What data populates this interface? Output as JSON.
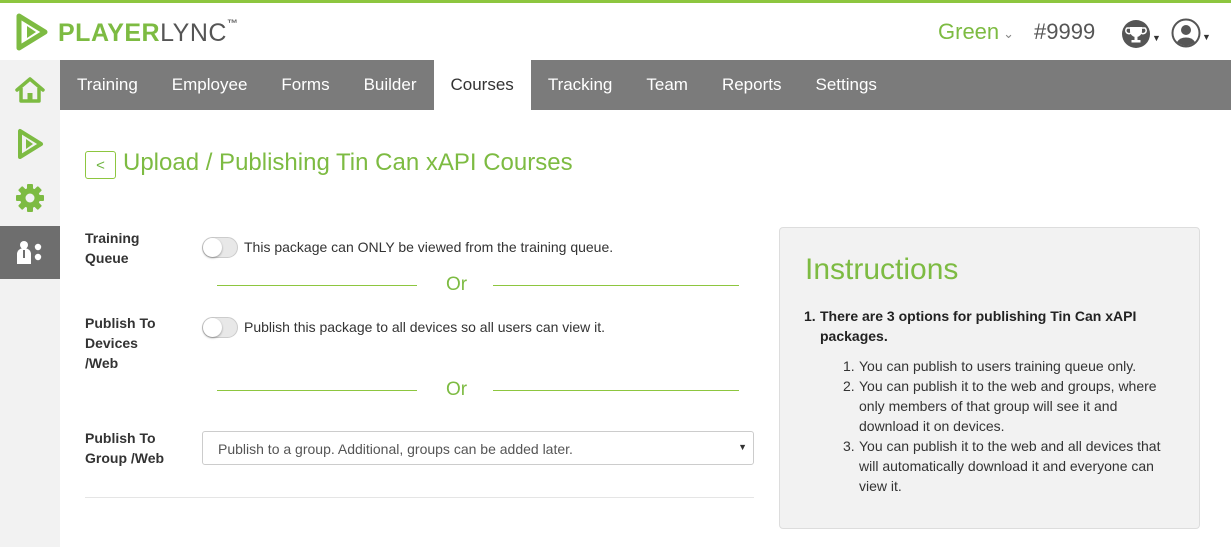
{
  "header": {
    "logo_player": "PLAYER",
    "logo_lync": "LYNC",
    "logo_tm": "™",
    "account_name": "Green",
    "account_id": "#9999"
  },
  "sidebar": {
    "items": [
      {
        "icon": "home-icon"
      },
      {
        "icon": "play-icon"
      },
      {
        "icon": "gear-icon"
      },
      {
        "icon": "users-icon",
        "active": true
      }
    ]
  },
  "nav": {
    "tabs": [
      {
        "label": "Training"
      },
      {
        "label": "Employee"
      },
      {
        "label": "Forms"
      },
      {
        "label": "Builder"
      },
      {
        "label": "Courses",
        "active": true
      },
      {
        "label": "Tracking"
      },
      {
        "label": "Team"
      },
      {
        "label": "Reports"
      },
      {
        "label": "Settings"
      }
    ]
  },
  "page": {
    "back_label": "<",
    "title": "Upload / Publishing Tin Can xAPI Courses"
  },
  "form": {
    "training_queue": {
      "label_line1": "Training",
      "label_line2": "Queue",
      "toggle_text": "This package can ONLY be viewed from the training queue.",
      "on": false
    },
    "or_1": "Or",
    "publish_devices": {
      "label_line1": "Publish To",
      "label_line2": "Devices",
      "label_line3": "/Web",
      "toggle_text": "Publish this package to all devices so all users can view it.",
      "on": false
    },
    "or_2": "Or",
    "publish_group": {
      "label_line1": "Publish To",
      "label_line2": "Group /Web",
      "select_value": "Publish to a group. Additional, groups can be added later."
    }
  },
  "instructions": {
    "title": "Instructions",
    "main_num": "1.",
    "main_text": "There are 3 options for publishing Tin Can xAPI packages.",
    "items": [
      {
        "num": "1.",
        "text": "You can publish to users training queue only."
      },
      {
        "num": "2.",
        "text": "You can publish it to the web and groups, where only members of that group will see it and download it on devices."
      },
      {
        "num": "3.",
        "text": "You can publish it to the web and all devices that will automatically download it and everyone can view it."
      }
    ]
  },
  "colors": {
    "brand_green": "#7dbb42",
    "nav_gray": "#7b7b7b",
    "rail_active": "#6e6e6e"
  }
}
